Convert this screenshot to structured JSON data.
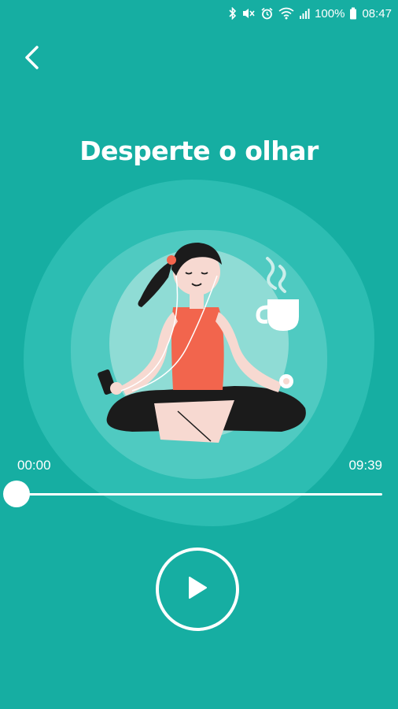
{
  "status_bar": {
    "battery": "100%",
    "time": "08:47",
    "icons": [
      "bluetooth-icon",
      "mute-icon",
      "alarm-icon",
      "wifi-icon",
      "signal-icon",
      "battery-icon"
    ]
  },
  "header": {
    "back_icon": "chevron-left-icon"
  },
  "player": {
    "title": "Desperte o olhar",
    "current_time": "00:00",
    "total_time": "09:39",
    "progress": 0,
    "play_icon": "play-icon"
  },
  "colors": {
    "background": "#16aea2",
    "blob_outer": "#2cbdb2",
    "blob_mid": "#4fcac1",
    "blob_inner": "#8fdcd5",
    "accent_shirt": "#f2654d",
    "foreground": "#ffffff"
  }
}
